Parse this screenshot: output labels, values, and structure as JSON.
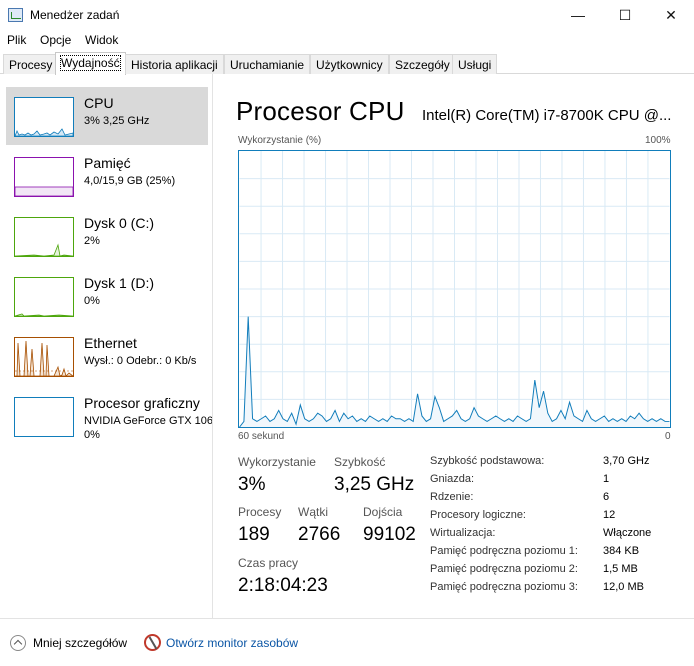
{
  "window": {
    "title": "Menedżer zadań",
    "minimize_glyph": "—",
    "maximize_glyph": "☐",
    "close_glyph": "✕"
  },
  "menu": [
    "Plik",
    "Opcje",
    "Widok"
  ],
  "tabs": [
    "Procesy",
    "Wydajność",
    "Historia aplikacji",
    "Uruchamianie",
    "Użytkownicy",
    "Szczegóły",
    "Usługi"
  ],
  "active_tab": "Wydajność",
  "sidebar": {
    "items": [
      {
        "name": "CPU",
        "sub": "3%  3,25 GHz",
        "color": "#117dbb"
      },
      {
        "name": "Pamięć",
        "sub": "4,0/15,9 GB (25%)",
        "color": "#8b12ae"
      },
      {
        "name": "Dysk 0 (C:)",
        "sub": "2%",
        "color": "#4da60c"
      },
      {
        "name": "Dysk 1 (D:)",
        "sub": "0%",
        "color": "#4da60c"
      },
      {
        "name": "Ethernet",
        "sub": "Wysł.: 0 Odebr.: 0 Kb/s",
        "color": "#a74f01"
      },
      {
        "name": "Procesor graficzny",
        "sub": "NVIDIA GeForce GTX 1060",
        "sub2": "0%",
        "color": "#117dbb"
      }
    ]
  },
  "main": {
    "title": "Procesor CPU",
    "model": "Intel(R) Core(TM) i7-8700K CPU @...",
    "graph_top_left": "Wykorzystanie (%)",
    "graph_top_right": "100%",
    "graph_bottom_left": "60 sekund",
    "graph_bottom_right": "0",
    "graph_color": "#117dbb",
    "utilization_series": [
      0,
      2,
      40,
      3,
      2,
      3,
      4,
      2,
      3,
      6,
      3,
      2,
      5,
      1,
      8,
      3,
      2,
      3,
      5,
      4,
      2,
      3,
      6,
      2,
      5,
      3,
      4,
      2,
      3,
      2,
      4,
      3,
      2,
      3,
      2,
      4,
      3,
      3,
      2,
      3,
      2,
      12,
      4,
      2,
      3,
      11,
      7,
      2,
      3,
      4,
      6,
      3,
      2,
      3,
      7,
      4,
      3,
      2,
      3,
      4,
      3,
      2,
      3,
      2,
      4,
      3,
      2,
      3,
      17,
      7,
      13,
      5,
      2,
      3,
      6,
      3,
      9,
      4,
      3,
      2,
      6,
      3,
      2,
      3,
      4,
      2,
      3,
      2,
      3,
      2,
      4,
      3,
      5,
      3,
      2,
      3,
      2,
      3,
      2,
      2
    ],
    "stats": {
      "utilization_label": "Wykorzystanie",
      "utilization_value": "3%",
      "speed_label": "Szybkość",
      "speed_value": "3,25 GHz",
      "processes_label": "Procesy",
      "processes_value": "189",
      "threads_label": "Wątki",
      "threads_value": "2766",
      "handles_label": "Dojścia",
      "handles_value": "99102",
      "uptime_label": "Czas pracy",
      "uptime_value": "2:18:04:23"
    },
    "specs": [
      {
        "label": "Szybkość podstawowa:",
        "value": "3,70 GHz"
      },
      {
        "label": "Gniazda:",
        "value": "1"
      },
      {
        "label": "Rdzenie:",
        "value": "6"
      },
      {
        "label": "Procesory logiczne:",
        "value": "12"
      },
      {
        "label": "Wirtualizacja:",
        "value": "Włączone"
      },
      {
        "label": "Pamięć podręczna poziomu 1:",
        "value": "384 KB"
      },
      {
        "label": "Pamięć podręczna poziomu 2:",
        "value": "1,5 MB"
      },
      {
        "label": "Pamięć podręczna poziomu 3:",
        "value": "12,0 MB"
      }
    ]
  },
  "footer": {
    "fewer_details": "Mniej szczegółów",
    "open_monitor": "Otwórz monitor zasobów"
  }
}
